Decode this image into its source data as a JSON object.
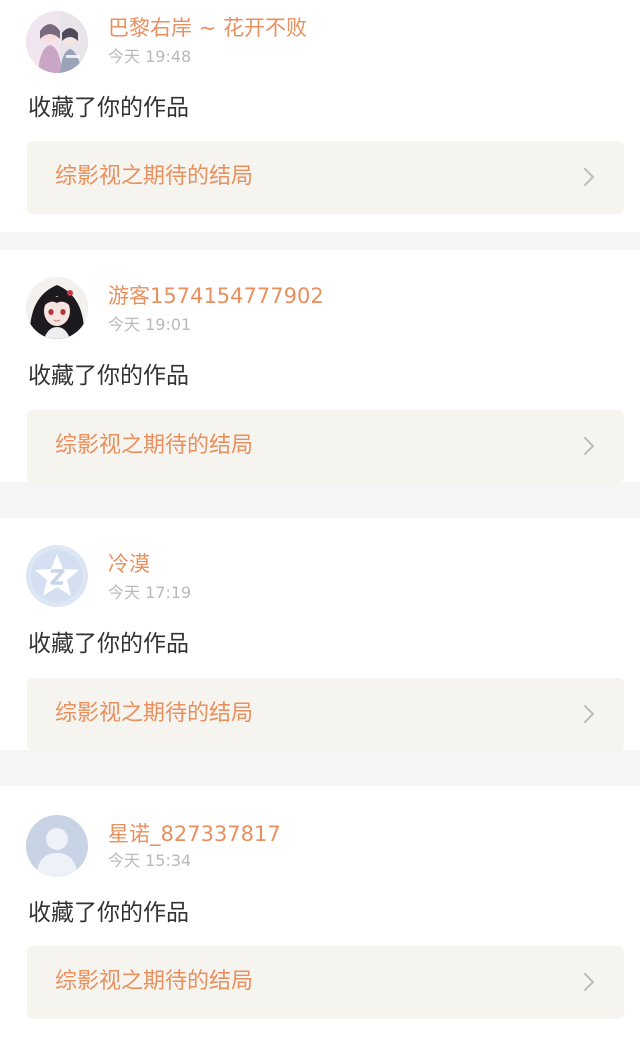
{
  "notifications": [
    {
      "username": "巴黎右岸 ~ 花开不败",
      "time": "今天 19:48",
      "action": "收藏了你的作品",
      "work_title": "综影视之期待的结局",
      "avatar_icon": "anime-couple-avatar"
    },
    {
      "username": "游客1574154777902",
      "time": "今天 19:01",
      "action": "收藏了你的作品",
      "work_title": "综影视之期待的结局",
      "avatar_icon": "anime-girl-avatar"
    },
    {
      "username": "冷漠",
      "time": "今天 17:19",
      "action": "收藏了你的作品",
      "work_title": "综影视之期待的结局",
      "avatar_icon": "default-star-avatar"
    },
    {
      "username": "星诺_827337817",
      "time": "今天 15:34",
      "action": "收藏了你的作品",
      "work_title": "综影视之期待的结局",
      "avatar_icon": "default-person-avatar"
    }
  ],
  "colors": {
    "accent": "#e9905f",
    "timestamp": "#b9b9b9",
    "body_text": "#333333",
    "link_bg": "#f5f4ee",
    "separator": "#f6f5f5"
  },
  "icons": {
    "chevron": "chevron-right-icon"
  }
}
